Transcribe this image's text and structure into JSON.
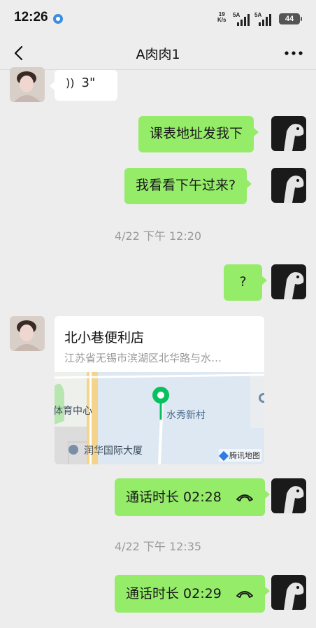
{
  "status_bar": {
    "time": "12:26",
    "net_speed_value": "19",
    "net_speed_unit": "K/s",
    "sim1": "5A",
    "sim2": "5A",
    "battery": "44"
  },
  "header": {
    "title": "A肉肉1",
    "back_icon": "chevron-left-icon",
    "more_icon": "more-dots-icon"
  },
  "messages": {
    "voice": {
      "duration": "3\""
    },
    "m1": "课表地址发我下",
    "m2": "我看看下午过来?",
    "ts1": "4/22 下午 12:20",
    "m3": "?",
    "location": {
      "name": "北小巷便利店",
      "address": "江苏省无锡市滨湖区北华路与水…",
      "map_label_1": "体育中心",
      "map_label_2": "水秀新村",
      "map_label_3": "润华国际大厦",
      "map_provider": "腾讯地图"
    },
    "call1": "通话时长 02:28",
    "ts2": "4/22 下午 12:35",
    "call2": "通话时长 02:29"
  },
  "colors": {
    "background": "#ededed",
    "sent_bubble": "#95ec69",
    "received_bubble": "#ffffff",
    "map_pin": "#07c160"
  }
}
